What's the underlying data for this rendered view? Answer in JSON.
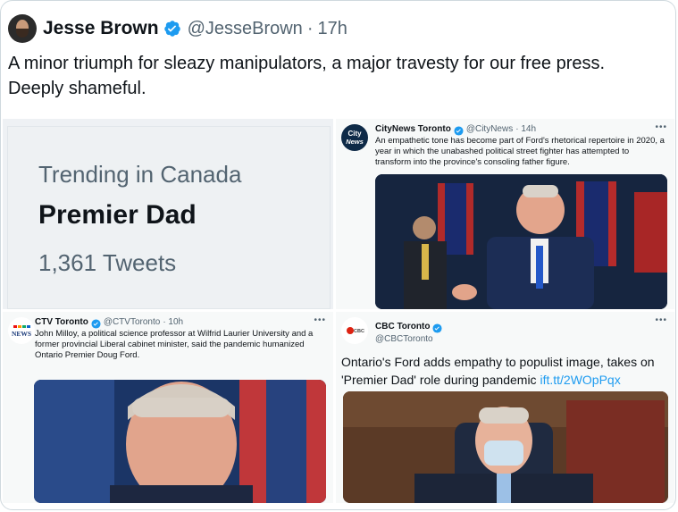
{
  "tweet": {
    "author_name": "Jesse Brown",
    "handle": "@JesseBrown",
    "separator": "·",
    "time": "17h",
    "text": "A minor triumph for sleazy manipulators, a major travesty for our free press. Deeply shameful."
  },
  "trend_card": {
    "label": "Trending in Canada",
    "name": "Premier Dad",
    "count": "1,361 Tweets"
  },
  "quote_citynews": {
    "logo_text": "City News",
    "name": "CityNews Toronto",
    "handle": "@CityNews",
    "time": "· 14h",
    "more": "•••",
    "text": "An empathetic tone has become part of Ford's rhetorical repertoire in 2020, a year in which the unabashed political street fighter has attempted to transform into the province's consoling father figure."
  },
  "quote_ctv": {
    "logo_text": "NEWS",
    "name": "CTV Toronto",
    "handle": "@CTVToronto",
    "time": "· 10h",
    "more": "•••",
    "text": "John Milloy, a political science professor at Wilfrid Laurier University and a former provincial Liberal cabinet minister, said the pandemic humanized Ontario Premier Doug Ford."
  },
  "quote_cbc": {
    "logo_text": "CBC",
    "name": "CBC Toronto",
    "handle": "@CBCToronto",
    "more": "•••",
    "text": "Ontario's Ford adds empathy to populist image, takes on 'Premier Dad' role during pandemic",
    "link": "ift.tt/2WOpPqx"
  },
  "colors": {
    "accent": "#1d9bf0",
    "secondary_text": "#536471"
  }
}
